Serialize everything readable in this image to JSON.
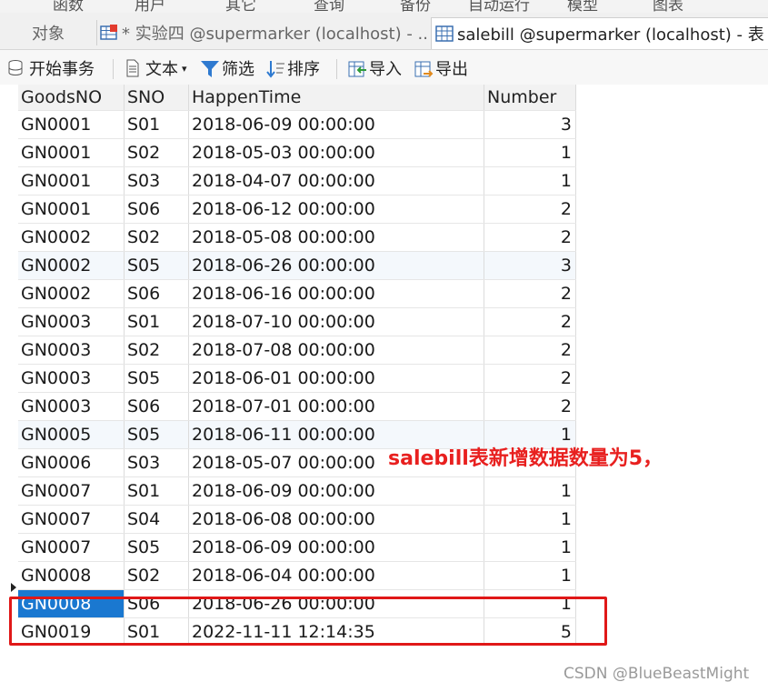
{
  "top_menu": [
    "函数",
    "用户",
    "其它",
    "查询",
    "备份",
    "自动运行",
    "模型",
    "图表"
  ],
  "tabs": [
    {
      "label": "对象"
    },
    {
      "label": "* 实验四 @supermarker (localhost) - ..."
    },
    {
      "label": "salebill @supermarker (localhost) - 表"
    }
  ],
  "toolbar": {
    "begin_transaction": "开始事务",
    "text": "文本",
    "filter": "筛选",
    "sort": "排序",
    "import": "导入",
    "export": "导出"
  },
  "table": {
    "columns": [
      "GoodsNO",
      "SNO",
      "HappenTime",
      "Number"
    ],
    "rows": [
      [
        "GN0001",
        "S01",
        "2018-06-09 00:00:00",
        "3"
      ],
      [
        "GN0001",
        "S02",
        "2018-05-03 00:00:00",
        "1"
      ],
      [
        "GN0001",
        "S03",
        "2018-04-07 00:00:00",
        "1"
      ],
      [
        "GN0001",
        "S06",
        "2018-06-12 00:00:00",
        "2"
      ],
      [
        "GN0002",
        "S02",
        "2018-05-08 00:00:00",
        "2"
      ],
      [
        "GN0002",
        "S05",
        "2018-06-26 00:00:00",
        "3"
      ],
      [
        "GN0002",
        "S06",
        "2018-06-16 00:00:00",
        "2"
      ],
      [
        "GN0003",
        "S01",
        "2018-07-10 00:00:00",
        "2"
      ],
      [
        "GN0003",
        "S02",
        "2018-07-08 00:00:00",
        "2"
      ],
      [
        "GN0003",
        "S05",
        "2018-06-01 00:00:00",
        "2"
      ],
      [
        "GN0003",
        "S06",
        "2018-07-01 00:00:00",
        "2"
      ],
      [
        "GN0005",
        "S05",
        "2018-06-11 00:00:00",
        "1"
      ],
      [
        "GN0006",
        "S03",
        "2018-05-07 00:00:00",
        ""
      ],
      [
        "GN0007",
        "S01",
        "2018-06-09 00:00:00",
        "1"
      ],
      [
        "GN0007",
        "S04",
        "2018-06-08 00:00:00",
        "1"
      ],
      [
        "GN0007",
        "S05",
        "2018-06-09 00:00:00",
        "1"
      ],
      [
        "GN0008",
        "S02",
        "2018-06-04 00:00:00",
        "1"
      ],
      [
        "GN0008",
        "S06",
        "2018-06-26 00:00:00",
        "1"
      ],
      [
        "GN0019",
        "S01",
        "2022-11-11 12:14:35",
        "5"
      ]
    ]
  },
  "annotation": "salebill表新增数据数量为5，",
  "watermark": "CSDN @BlueBeastMight",
  "colors": {
    "selection": "#1a78d0",
    "highlight": "#e01818"
  }
}
